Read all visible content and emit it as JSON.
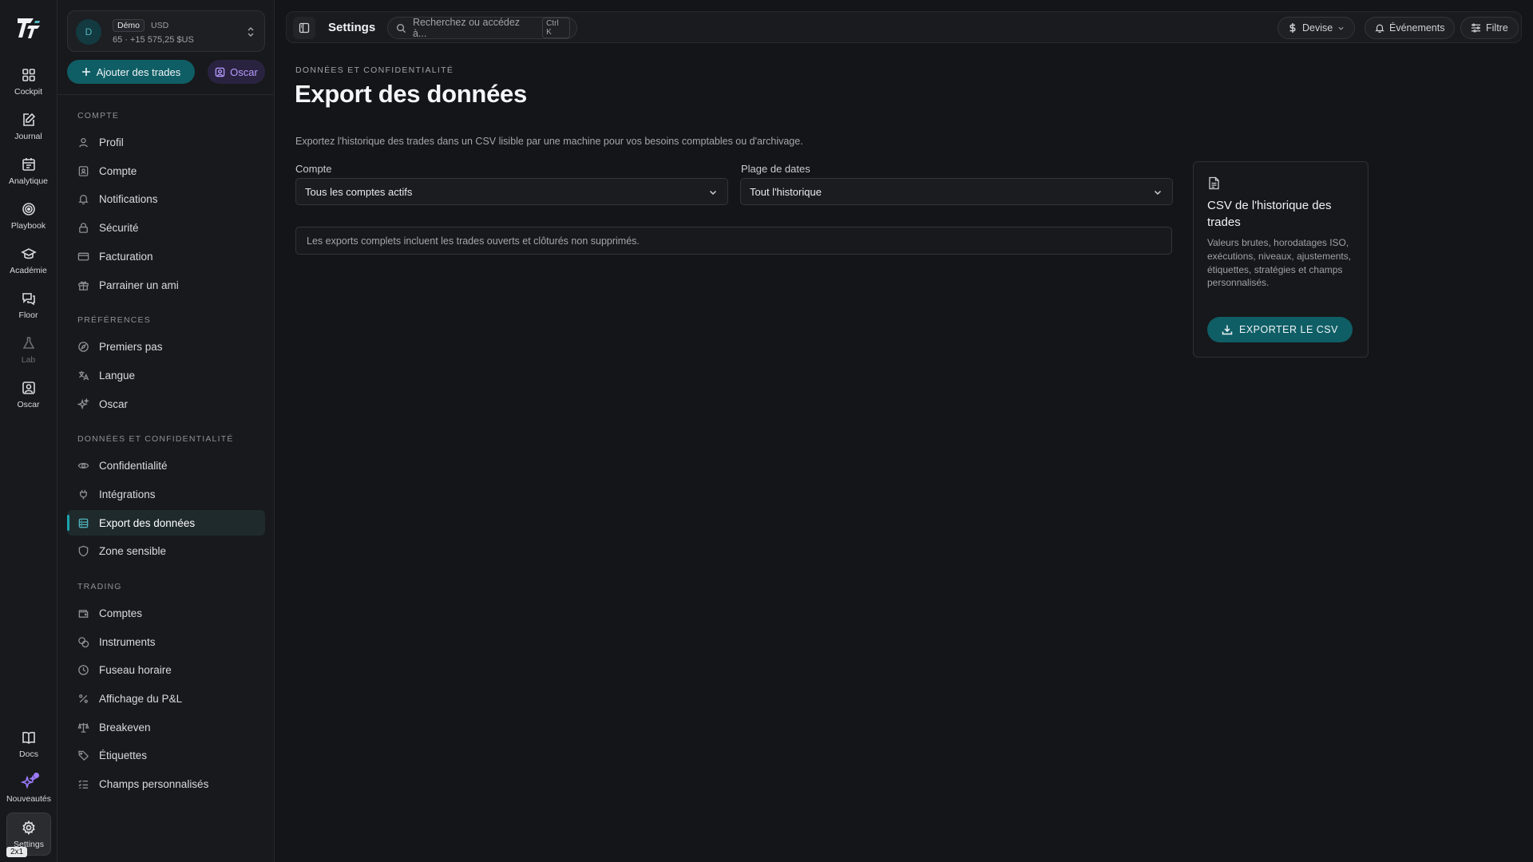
{
  "rail": {
    "items": [
      {
        "label": "Cockpit",
        "icon": "grid-icon"
      },
      {
        "label": "Journal",
        "icon": "edit-icon"
      },
      {
        "label": "Analytique",
        "icon": "calendar-icon"
      },
      {
        "label": "Playbook",
        "icon": "target-icon"
      },
      {
        "label": "Académie",
        "icon": "graduation-icon"
      },
      {
        "label": "Floor",
        "icon": "chat-icon"
      },
      {
        "label": "Lab",
        "icon": "flask-icon"
      },
      {
        "label": "Oscar",
        "icon": "user-square-icon"
      }
    ],
    "bottom": [
      {
        "label": "Docs",
        "icon": "book-icon"
      },
      {
        "label": "Nouveautés",
        "icon": "sparkles-icon"
      },
      {
        "label": "Settings",
        "icon": "gear-icon"
      }
    ],
    "badge": "2x1"
  },
  "account": {
    "avatar": "D",
    "mode": "Démo",
    "currency": "USD",
    "summary": "65 · +15 575,25 $US"
  },
  "actions": {
    "add_trades": "Ajouter des trades",
    "oscar": "Oscar"
  },
  "sidebar": {
    "groups": [
      {
        "label": "COMPTE",
        "items": [
          {
            "label": "Profil",
            "icon": "user-icon"
          },
          {
            "label": "Compte",
            "icon": "id-card-icon"
          },
          {
            "label": "Notifications",
            "icon": "bell-icon"
          },
          {
            "label": "Sécurité",
            "icon": "lock-icon"
          },
          {
            "label": "Facturation",
            "icon": "credit-card-icon"
          },
          {
            "label": "Parrainer un ami",
            "icon": "gift-icon"
          }
        ]
      },
      {
        "label": "PRÉFÉRENCES",
        "items": [
          {
            "label": "Premiers pas",
            "icon": "compass-icon"
          },
          {
            "label": "Langue",
            "icon": "translate-icon"
          },
          {
            "label": "Oscar",
            "icon": "sparkles-icon"
          }
        ]
      },
      {
        "label": "DONNÉES ET CONFIDENTIALITÉ",
        "items": [
          {
            "label": "Confidentialité",
            "icon": "eye-icon"
          },
          {
            "label": "Intégrations",
            "icon": "plug-icon"
          },
          {
            "label": "Export des données",
            "icon": "database-icon",
            "active": true
          },
          {
            "label": "Zone sensible",
            "icon": "shield-icon"
          }
        ]
      },
      {
        "label": "TRADING",
        "items": [
          {
            "label": "Comptes",
            "icon": "wallet-icon"
          },
          {
            "label": "Instruments",
            "icon": "coins-icon"
          },
          {
            "label": "Fuseau horaire",
            "icon": "clock-icon"
          },
          {
            "label": "Affichage du P&L",
            "icon": "percent-icon"
          },
          {
            "label": "Breakeven",
            "icon": "scale-icon"
          },
          {
            "label": "Étiquettes",
            "icon": "tag-icon"
          },
          {
            "label": "Champs personnalisés",
            "icon": "list-check-icon"
          }
        ]
      }
    ]
  },
  "topbar": {
    "title": "Settings",
    "search_placeholder": "Recherchez ou accédez à...",
    "shortcut": "Ctrl K",
    "currency": "Devise",
    "events": "Événements",
    "filter": "Filtre"
  },
  "main": {
    "eyebrow": "DONNÉES ET CONFIDENTIALITÉ",
    "title": "Export des données",
    "description": "Exportez l'historique des trades dans un CSV lisible par une machine pour vos besoins comptables ou d'archivage.",
    "account_label": "Compte",
    "account_value": "Tous les comptes actifs",
    "range_label": "Plage de dates",
    "range_value": "Tout l'historique",
    "note": "Les exports complets incluent les trades ouverts et clôturés non supprimés."
  },
  "export_card": {
    "title": "CSV de l'historique des trades",
    "body": "Valeurs brutes, horodatages ISO, exécutions, niveaux, ajustements, étiquettes, stratégies et champs personnalisés.",
    "button": "EXPORTER LE CSV"
  },
  "colors": {
    "accent": "#0f5e66",
    "accent_light": "#1aa3b0",
    "oscar_purple": "#b69cff",
    "background": "#141518"
  }
}
